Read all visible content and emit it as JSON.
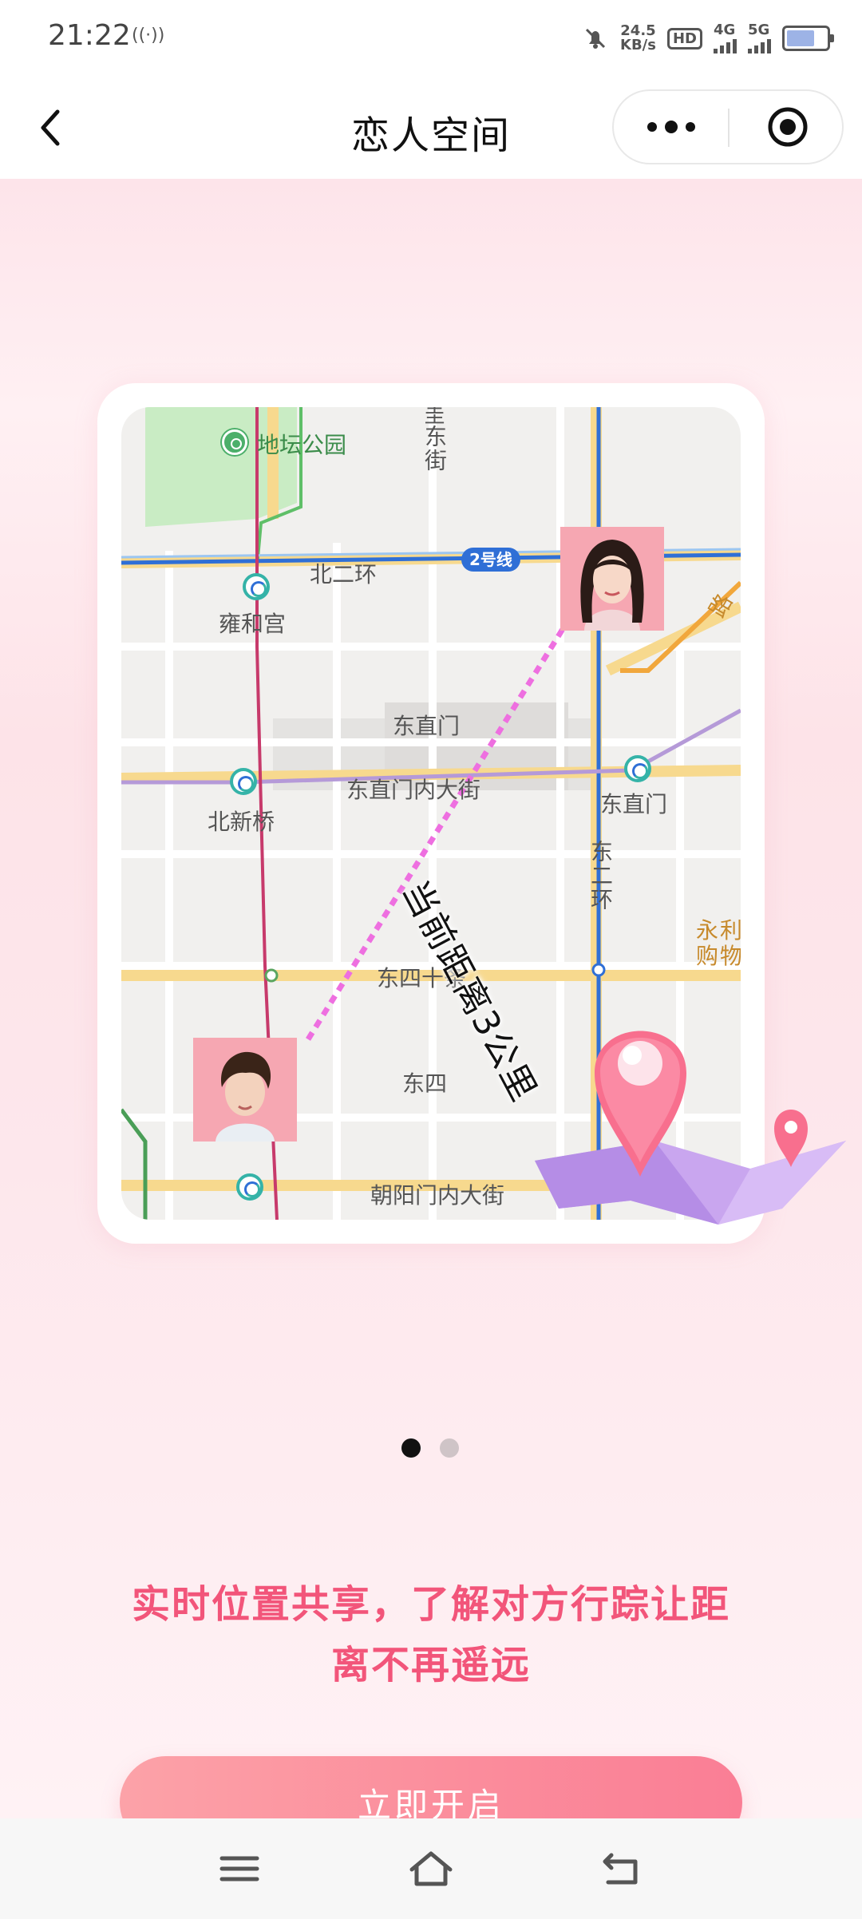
{
  "status_bar": {
    "time": "21:22",
    "signal_mark": "((·))",
    "net_speed_value": "24.5",
    "net_speed_unit": "KB/s",
    "hd_badge": "HD",
    "net_1": "4G",
    "net_2": "5G",
    "icons": [
      "mute-icon",
      "signal-icon",
      "battery-icon"
    ]
  },
  "nav": {
    "back_icon": "chevron-left-icon",
    "title": "恋人空间",
    "more_icon": "more-dots-icon",
    "close_icon": "target-close-icon"
  },
  "map": {
    "labels": {
      "park": "地坛公园",
      "street_top": "东街",
      "street_top_prefix": "圭",
      "north_ring": "北二环",
      "metro_line": "2号线",
      "yonghegong": "雍和宫",
      "dongzhimen_top": "东直门",
      "dongzhimen_inner": "东直门内大街",
      "dongzhimen_station": "东直门",
      "beixinqiao": "北新桥",
      "east_second_ring": "东二环",
      "yongli": "永利购物",
      "dongsishitiao": "东四十条",
      "dongsi": "东四",
      "chaoyangmen": "朝阳门内大街",
      "road_edge": "路"
    },
    "distance_text": "当前距离3公里",
    "colors": {
      "main_road": "#f7d98e",
      "ring_road_blue": "#2f6fd6",
      "metro_red": "#c73a6b",
      "metro_purple": "#b59ad8",
      "park_green": "#c9ecc4",
      "dashed_line": "#ee6fe0"
    }
  },
  "carousel": {
    "current": 1,
    "total": 2
  },
  "slogan": {
    "line1": "实时位置共享，了解对方行踪让距",
    "line2": "离不再遥远"
  },
  "cta": {
    "label": "立即开启",
    "color_start": "#fca2a8",
    "color_end": "#fa7e95"
  },
  "system_nav": {
    "icons": [
      "menu-icon",
      "home-icon",
      "back-icon"
    ]
  }
}
